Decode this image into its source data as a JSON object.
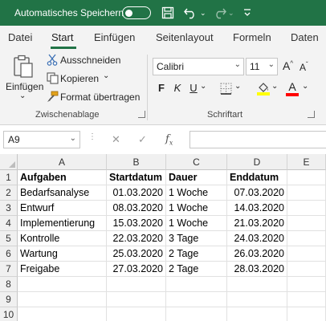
{
  "titlebar": {
    "autosave_label": "Automatisches Speichern",
    "autosave_state": "off",
    "bg_color": "#217346"
  },
  "tabs": [
    {
      "label": "Datei",
      "active": false
    },
    {
      "label": "Start",
      "active": true
    },
    {
      "label": "Einfügen",
      "active": false
    },
    {
      "label": "Seitenlayout",
      "active": false
    },
    {
      "label": "Formeln",
      "active": false
    },
    {
      "label": "Daten",
      "active": false
    }
  ],
  "ribbon": {
    "clipboard": {
      "paste_label": "Einfügen",
      "cut_label": "Ausschneiden",
      "copy_label": "Kopieren",
      "format_painter_label": "Format übertragen",
      "group_label": "Zwischenablage"
    },
    "font": {
      "font_name": "Calibri",
      "font_size": "11",
      "bold": "F",
      "italic": "K",
      "underline": "U",
      "grow": "A",
      "shrink": "A",
      "font_color_label": "A",
      "group_label": "Schriftart",
      "highlight_color": "#ffff00",
      "font_color": "#ff0000"
    }
  },
  "formula_bar": {
    "name_box": "A9",
    "formula": ""
  },
  "sheet": {
    "columns": [
      "A",
      "B",
      "C",
      "D",
      "E"
    ],
    "rows": [
      "1",
      "2",
      "3",
      "4",
      "5",
      "6",
      "7",
      "8",
      "9",
      "10"
    ],
    "cells": [
      [
        "Aufgaben",
        "Startdatum",
        "Dauer",
        "Enddatum",
        ""
      ],
      [
        "Bedarfsanalyse",
        "01.03.2020",
        "1 Woche",
        "07.03.2020",
        ""
      ],
      [
        "Entwurf",
        "08.03.2020",
        "1 Woche",
        "14.03.2020",
        ""
      ],
      [
        "Implementierung",
        "15.03.2020",
        "1 Woche",
        "21.03.2020",
        ""
      ],
      [
        "Kontrolle",
        "22.03.2020",
        "3 Tage",
        "24.03.2020",
        ""
      ],
      [
        "Wartung",
        "25.03.2020",
        "2 Tage",
        "26.03.2020",
        ""
      ],
      [
        "Freigabe",
        "27.03.2020",
        "2 Tage",
        "28.03.2020",
        ""
      ],
      [
        "",
        "",
        "",
        "",
        ""
      ],
      [
        "",
        "",
        "",
        "",
        ""
      ],
      [
        "",
        "",
        "",
        "",
        ""
      ]
    ]
  }
}
